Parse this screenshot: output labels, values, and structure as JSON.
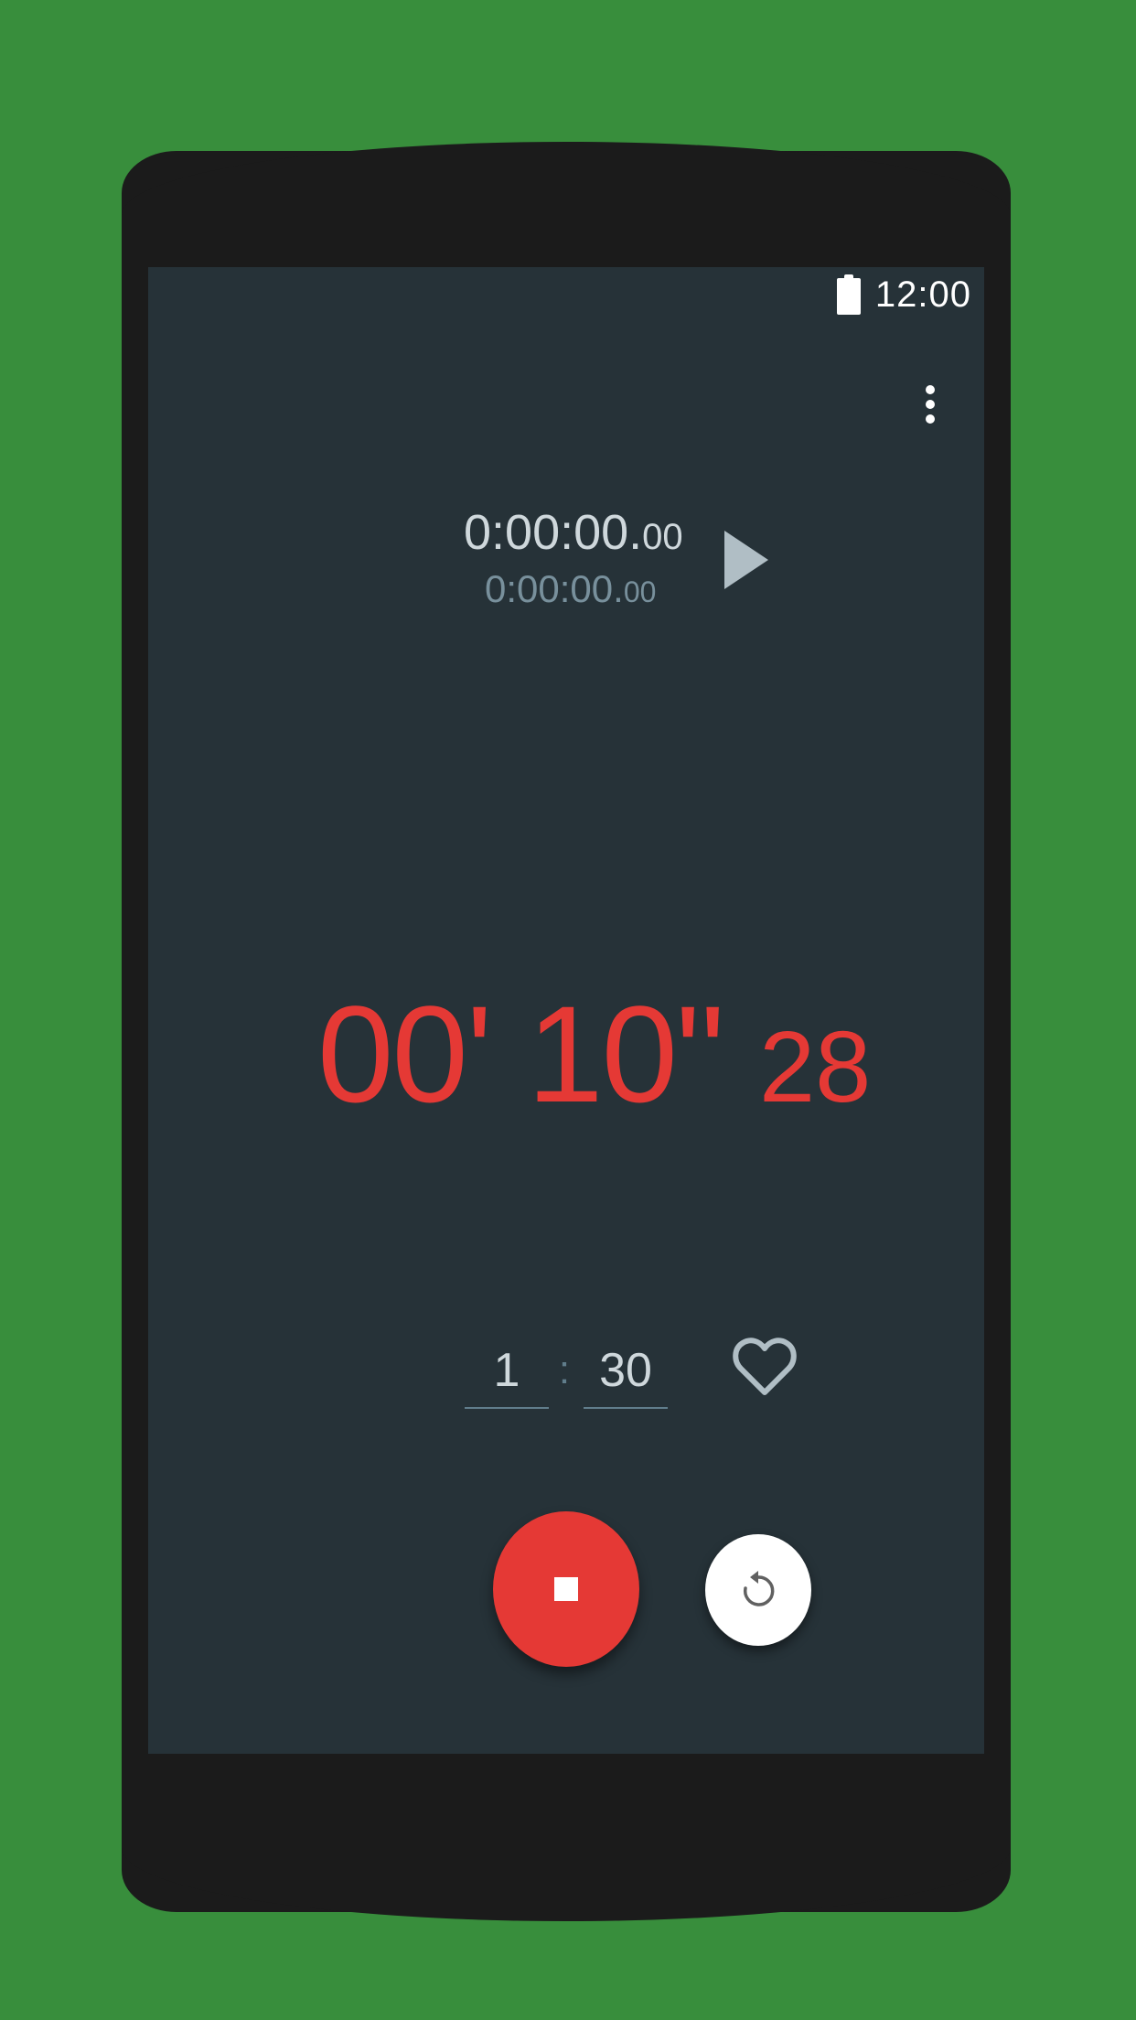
{
  "status_bar": {
    "time": "12:00",
    "battery_icon": "battery-full-icon"
  },
  "toolbar": {
    "menu_icon": "more-vert-icon"
  },
  "lap": {
    "total_main": "0:00:00.",
    "total_ms": "00",
    "split_main": "0:00:00.",
    "split_ms": "00",
    "play_icon": "play-arrow-icon"
  },
  "timer": {
    "minutes": "00'",
    "seconds": "10\"",
    "hundredths": "28"
  },
  "interval": {
    "minutes": "1",
    "separator": ":",
    "seconds": "30",
    "favorite_icon": "heart-outline-icon"
  },
  "controls": {
    "stop_icon": "stop-icon",
    "reset_icon": "replay-icon"
  },
  "colors": {
    "background": "#388e3c",
    "screen": "#263238",
    "accent": "#e53935",
    "text_primary": "#cfd8dc",
    "text_secondary": "#78909c"
  }
}
